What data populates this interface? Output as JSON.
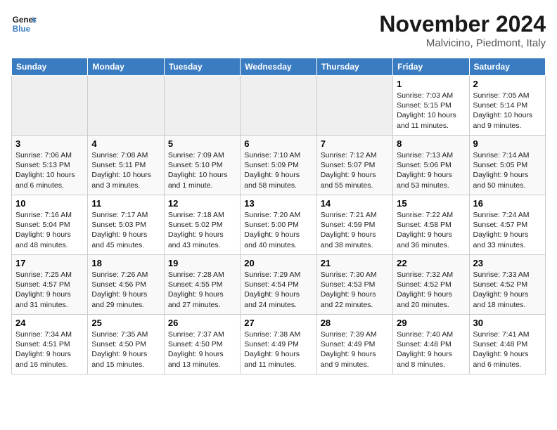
{
  "header": {
    "logo_line1": "General",
    "logo_line2": "Blue",
    "month": "November 2024",
    "location": "Malvicino, Piedmont, Italy"
  },
  "weekdays": [
    "Sunday",
    "Monday",
    "Tuesday",
    "Wednesday",
    "Thursday",
    "Friday",
    "Saturday"
  ],
  "weeks": [
    [
      {
        "day": "",
        "empty": true
      },
      {
        "day": "",
        "empty": true
      },
      {
        "day": "",
        "empty": true
      },
      {
        "day": "",
        "empty": true
      },
      {
        "day": "",
        "empty": true
      },
      {
        "day": "1",
        "sunrise": "7:03 AM",
        "sunset": "5:15 PM",
        "daylight": "10 hours and 11 minutes."
      },
      {
        "day": "2",
        "sunrise": "7:05 AM",
        "sunset": "5:14 PM",
        "daylight": "10 hours and 9 minutes."
      }
    ],
    [
      {
        "day": "3",
        "sunrise": "7:06 AM",
        "sunset": "5:13 PM",
        "daylight": "10 hours and 6 minutes."
      },
      {
        "day": "4",
        "sunrise": "7:08 AM",
        "sunset": "5:11 PM",
        "daylight": "10 hours and 3 minutes."
      },
      {
        "day": "5",
        "sunrise": "7:09 AM",
        "sunset": "5:10 PM",
        "daylight": "10 hours and 1 minute."
      },
      {
        "day": "6",
        "sunrise": "7:10 AM",
        "sunset": "5:09 PM",
        "daylight": "9 hours and 58 minutes."
      },
      {
        "day": "7",
        "sunrise": "7:12 AM",
        "sunset": "5:07 PM",
        "daylight": "9 hours and 55 minutes."
      },
      {
        "day": "8",
        "sunrise": "7:13 AM",
        "sunset": "5:06 PM",
        "daylight": "9 hours and 53 minutes."
      },
      {
        "day": "9",
        "sunrise": "7:14 AM",
        "sunset": "5:05 PM",
        "daylight": "9 hours and 50 minutes."
      }
    ],
    [
      {
        "day": "10",
        "sunrise": "7:16 AM",
        "sunset": "5:04 PM",
        "daylight": "9 hours and 48 minutes."
      },
      {
        "day": "11",
        "sunrise": "7:17 AM",
        "sunset": "5:03 PM",
        "daylight": "9 hours and 45 minutes."
      },
      {
        "day": "12",
        "sunrise": "7:18 AM",
        "sunset": "5:02 PM",
        "daylight": "9 hours and 43 minutes."
      },
      {
        "day": "13",
        "sunrise": "7:20 AM",
        "sunset": "5:00 PM",
        "daylight": "9 hours and 40 minutes."
      },
      {
        "day": "14",
        "sunrise": "7:21 AM",
        "sunset": "4:59 PM",
        "daylight": "9 hours and 38 minutes."
      },
      {
        "day": "15",
        "sunrise": "7:22 AM",
        "sunset": "4:58 PM",
        "daylight": "9 hours and 36 minutes."
      },
      {
        "day": "16",
        "sunrise": "7:24 AM",
        "sunset": "4:57 PM",
        "daylight": "9 hours and 33 minutes."
      }
    ],
    [
      {
        "day": "17",
        "sunrise": "7:25 AM",
        "sunset": "4:57 PM",
        "daylight": "9 hours and 31 minutes."
      },
      {
        "day": "18",
        "sunrise": "7:26 AM",
        "sunset": "4:56 PM",
        "daylight": "9 hours and 29 minutes."
      },
      {
        "day": "19",
        "sunrise": "7:28 AM",
        "sunset": "4:55 PM",
        "daylight": "9 hours and 27 minutes."
      },
      {
        "day": "20",
        "sunrise": "7:29 AM",
        "sunset": "4:54 PM",
        "daylight": "9 hours and 24 minutes."
      },
      {
        "day": "21",
        "sunrise": "7:30 AM",
        "sunset": "4:53 PM",
        "daylight": "9 hours and 22 minutes."
      },
      {
        "day": "22",
        "sunrise": "7:32 AM",
        "sunset": "4:52 PM",
        "daylight": "9 hours and 20 minutes."
      },
      {
        "day": "23",
        "sunrise": "7:33 AM",
        "sunset": "4:52 PM",
        "daylight": "9 hours and 18 minutes."
      }
    ],
    [
      {
        "day": "24",
        "sunrise": "7:34 AM",
        "sunset": "4:51 PM",
        "daylight": "9 hours and 16 minutes."
      },
      {
        "day": "25",
        "sunrise": "7:35 AM",
        "sunset": "4:50 PM",
        "daylight": "9 hours and 15 minutes."
      },
      {
        "day": "26",
        "sunrise": "7:37 AM",
        "sunset": "4:50 PM",
        "daylight": "9 hours and 13 minutes."
      },
      {
        "day": "27",
        "sunrise": "7:38 AM",
        "sunset": "4:49 PM",
        "daylight": "9 hours and 11 minutes."
      },
      {
        "day": "28",
        "sunrise": "7:39 AM",
        "sunset": "4:49 PM",
        "daylight": "9 hours and 9 minutes."
      },
      {
        "day": "29",
        "sunrise": "7:40 AM",
        "sunset": "4:48 PM",
        "daylight": "9 hours and 8 minutes."
      },
      {
        "day": "30",
        "sunrise": "7:41 AM",
        "sunset": "4:48 PM",
        "daylight": "9 hours and 6 minutes."
      }
    ]
  ]
}
